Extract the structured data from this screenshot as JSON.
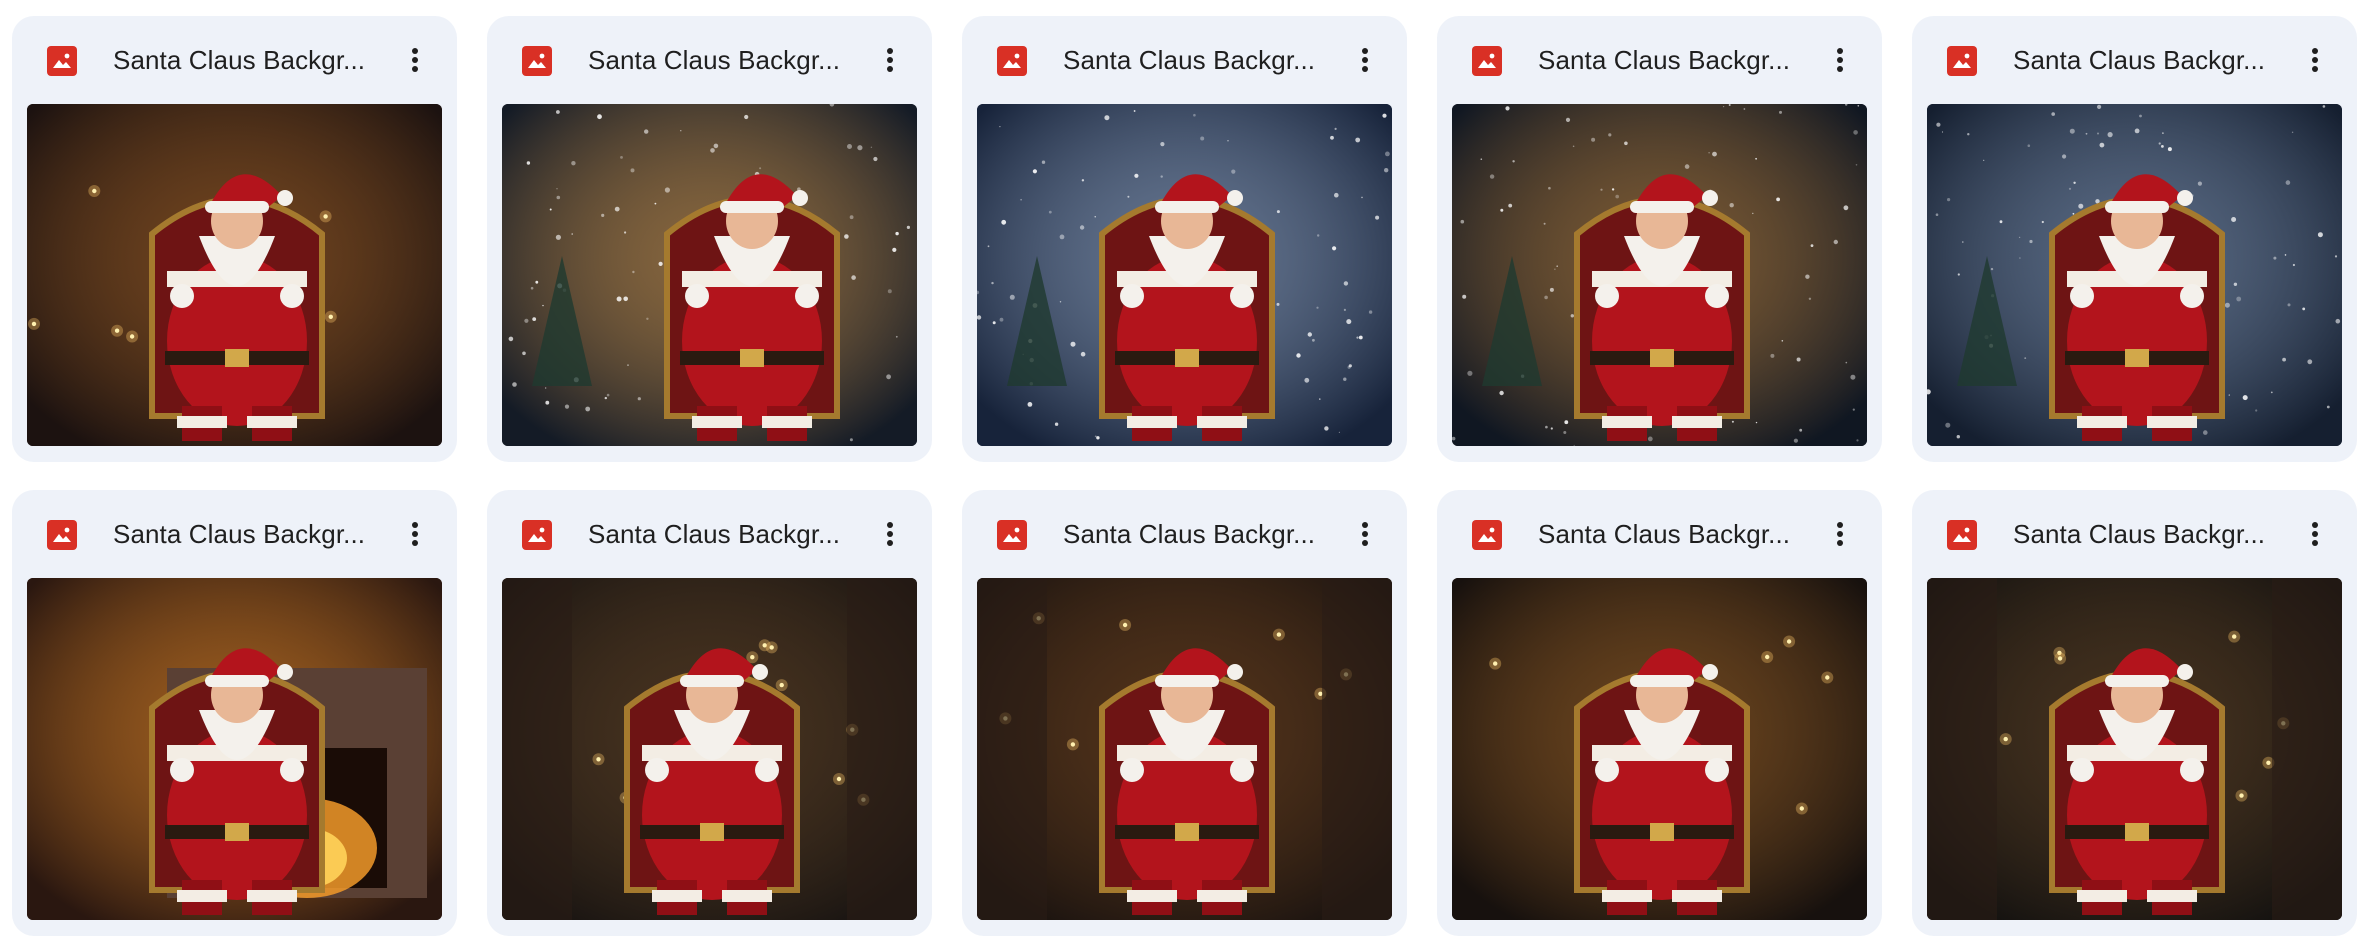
{
  "files": [
    {
      "name": "Santa Claus Backgr...",
      "icon": "image-file-icon",
      "scene": "candles",
      "bg": "#1c1210",
      "glow": "#b06a2a"
    },
    {
      "name": "Santa Claus Backgr...",
      "icon": "image-file-icon",
      "scene": "snow",
      "bg": "#141b26",
      "glow": "#e0a050"
    },
    {
      "name": "Santa Claus Backgr...",
      "icon": "image-file-icon",
      "scene": "snow",
      "bg": "#17233a",
      "glow": "#9fb3d0"
    },
    {
      "name": "Santa Claus Backgr...",
      "icon": "image-file-icon",
      "scene": "snow",
      "bg": "#101722",
      "glow": "#c98a40"
    },
    {
      "name": "Santa Claus Backgr...",
      "icon": "image-file-icon",
      "scene": "snow",
      "bg": "#151f30",
      "glow": "#8aa0c0"
    },
    {
      "name": "Santa Claus Backgr...",
      "icon": "image-file-icon",
      "scene": "fireplace",
      "bg": "#2a1710",
      "glow": "#f0902a"
    },
    {
      "name": "Santa Claus Backgr...",
      "icon": "image-file-icon",
      "scene": "throne",
      "bg": "#1a1512",
      "glow": "#6a4a2a"
    },
    {
      "name": "Santa Claus Backgr...",
      "icon": "image-file-icon",
      "scene": "throne",
      "bg": "#1c1410",
      "glow": "#7a4a22"
    },
    {
      "name": "Santa Claus Backgr...",
      "icon": "image-file-icon",
      "scene": "candles",
      "bg": "#17110e",
      "glow": "#a86a2a"
    },
    {
      "name": "Santa Claus Backgr...",
      "icon": "image-file-icon",
      "scene": "throne",
      "bg": "#141210",
      "glow": "#6a4a2a"
    }
  ],
  "more_icon": "more-vert-icon",
  "colors": {
    "card_bg": "#eef2f9",
    "icon_red": "#d93025",
    "text": "#1f1f1f"
  }
}
